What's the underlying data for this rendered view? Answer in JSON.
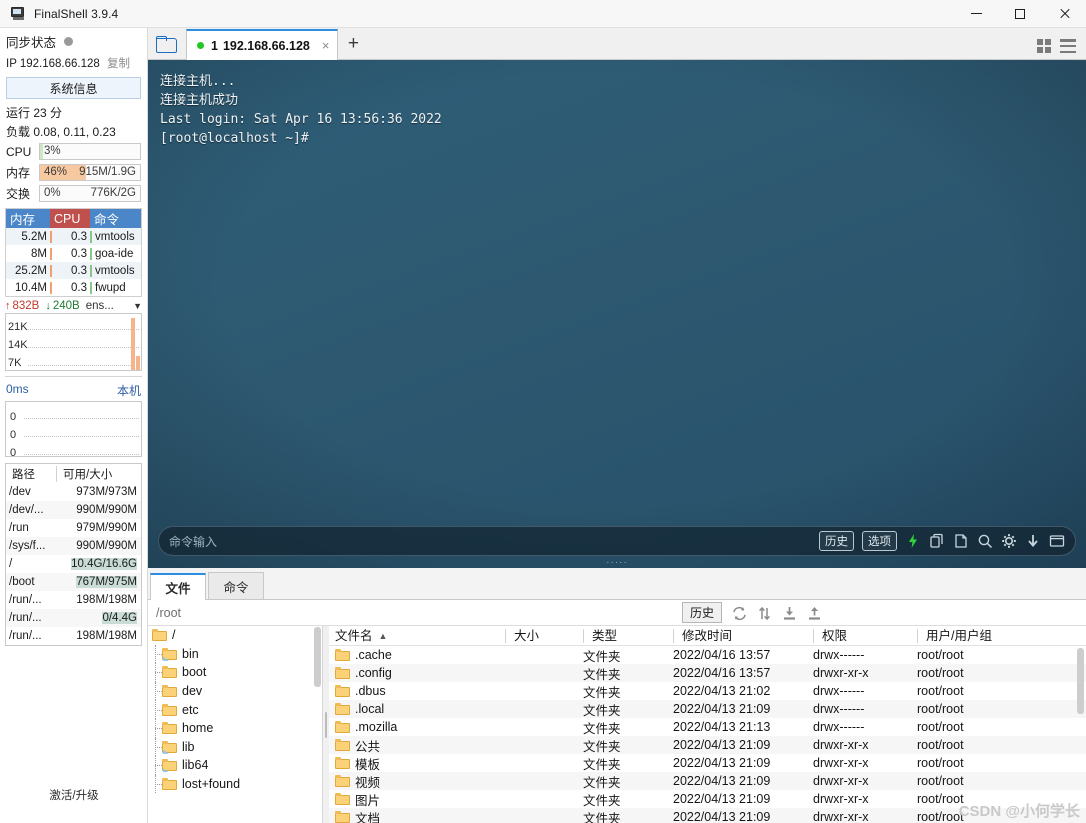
{
  "window": {
    "title": "FinalShell 3.9.4",
    "app_icon": "monitor-icon",
    "minimize": "—",
    "maximize": "□",
    "close": "✕"
  },
  "tabstrip": {
    "open_icon": "open-folder-icon",
    "tab": {
      "index": "1",
      "host": "192.168.66.128",
      "close": "×",
      "status": "connected"
    },
    "new_tab": "+",
    "grid_icon": "grid-view-icon",
    "menu_icon": "hamburger-menu-icon"
  },
  "sidebar": {
    "sync_label": "同步状态",
    "ip_label": "IP 192.168.66.128",
    "copy_label": "复制",
    "sysinfo_button": "系统信息",
    "uptime": "运行 23 分",
    "load": "负载 0.08, 0.11, 0.23",
    "meters": [
      {
        "label": "CPU",
        "percent": "3%",
        "value": "",
        "fill": 3,
        "color": "#cde9c0"
      },
      {
        "label": "内存",
        "percent": "46%",
        "value": "915M/1.9G",
        "fill": 46,
        "color": "#f7c9a0"
      },
      {
        "label": "交换",
        "percent": "0%",
        "value": "776K/2G",
        "fill": 0,
        "color": "#f7c9a0"
      }
    ],
    "process_table": {
      "headers": [
        "内存",
        "CPU",
        "命令"
      ],
      "header_colors": [
        "#4a86c8",
        "#c0504d",
        "#4a86c8"
      ],
      "rows": [
        [
          "5.2M",
          "0.3",
          "vmtools"
        ],
        [
          "8M",
          "0.3",
          "goa-ide"
        ],
        [
          "25.2M",
          "0.3",
          "vmtools"
        ],
        [
          "10.4M",
          "0.3",
          "fwupd"
        ]
      ]
    },
    "network": {
      "up": "832B",
      "down": "240B",
      "interface": "ens...",
      "up_arrow": "↑",
      "down_arrow": "↓",
      "caret": "▼",
      "y_labels": [
        "21K",
        "14K",
        "7K"
      ]
    },
    "latency": {
      "value": "0ms",
      "right_label": "本机",
      "y_labels": [
        "0",
        "0",
        "0"
      ]
    },
    "disk": {
      "headers": [
        "路径",
        "可用/大小"
      ],
      "rows": [
        {
          "path": "/dev",
          "value": "973M/973M",
          "highlight": false
        },
        {
          "path": "/dev/...",
          "value": "990M/990M",
          "highlight": false
        },
        {
          "path": "/run",
          "value": "979M/990M",
          "highlight": false
        },
        {
          "path": "/sys/f...",
          "value": "990M/990M",
          "highlight": false
        },
        {
          "path": "/",
          "value": "10.4G/16.6G",
          "highlight": true
        },
        {
          "path": "/boot",
          "value": "767M/975M",
          "highlight": true
        },
        {
          "path": "/run/...",
          "value": "198M/198M",
          "highlight": false
        },
        {
          "path": "/run/...",
          "value": "0/4.4G",
          "highlight": true
        },
        {
          "path": "/run/...",
          "value": "198M/198M",
          "highlight": false
        }
      ]
    },
    "activate": "激活/升级"
  },
  "terminal": {
    "lines": "连接主机...\n连接主机成功\nLast login: Sat Apr 16 13:56:36 2022\n[root@localhost ~]#",
    "command_placeholder": "命令输入",
    "history_button": "历史",
    "options_button": "选项",
    "icons": [
      "lightning-icon",
      "copy-icon",
      "paste-icon",
      "search-icon",
      "gear-icon",
      "download-icon",
      "window-icon"
    ],
    "drag_dots": "·····"
  },
  "file_panel": {
    "tabs": [
      {
        "label": "文件",
        "active": true
      },
      {
        "label": "命令",
        "active": false
      }
    ],
    "path": "/root",
    "history_button": "历史",
    "toolbar_icons": [
      "refresh-icon",
      "transfer-icon",
      "download-icon",
      "upload-icon"
    ],
    "tree": [
      {
        "label": "/",
        "depth": 0,
        "link": false
      },
      {
        "label": "bin",
        "depth": 1,
        "link": true
      },
      {
        "label": "boot",
        "depth": 1,
        "link": false
      },
      {
        "label": "dev",
        "depth": 1,
        "link": false
      },
      {
        "label": "etc",
        "depth": 1,
        "link": false
      },
      {
        "label": "home",
        "depth": 1,
        "link": false
      },
      {
        "label": "lib",
        "depth": 1,
        "link": true
      },
      {
        "label": "lib64",
        "depth": 1,
        "link": true
      },
      {
        "label": "lost+found",
        "depth": 1,
        "link": false
      }
    ],
    "columns": [
      "文件名",
      "大小",
      "类型",
      "修改时间",
      "权限",
      "用户/用户组"
    ],
    "sort_arrow": "▲",
    "rows": [
      {
        "name": ".cache",
        "size": "",
        "type": "文件夹",
        "mtime": "2022/04/16 13:57",
        "perm": "drwx------",
        "owner": "root/root"
      },
      {
        "name": ".config",
        "size": "",
        "type": "文件夹",
        "mtime": "2022/04/16 13:57",
        "perm": "drwxr-xr-x",
        "owner": "root/root"
      },
      {
        "name": ".dbus",
        "size": "",
        "type": "文件夹",
        "mtime": "2022/04/13 21:02",
        "perm": "drwx------",
        "owner": "root/root"
      },
      {
        "name": ".local",
        "size": "",
        "type": "文件夹",
        "mtime": "2022/04/13 21:09",
        "perm": "drwx------",
        "owner": "root/root"
      },
      {
        "name": ".mozilla",
        "size": "",
        "type": "文件夹",
        "mtime": "2022/04/13 21:13",
        "perm": "drwx------",
        "owner": "root/root"
      },
      {
        "name": "公共",
        "size": "",
        "type": "文件夹",
        "mtime": "2022/04/13 21:09",
        "perm": "drwxr-xr-x",
        "owner": "root/root"
      },
      {
        "name": "模板",
        "size": "",
        "type": "文件夹",
        "mtime": "2022/04/13 21:09",
        "perm": "drwxr-xr-x",
        "owner": "root/root"
      },
      {
        "name": "视频",
        "size": "",
        "type": "文件夹",
        "mtime": "2022/04/13 21:09",
        "perm": "drwxr-xr-x",
        "owner": "root/root"
      },
      {
        "name": "图片",
        "size": "",
        "type": "文件夹",
        "mtime": "2022/04/13 21:09",
        "perm": "drwxr-xr-x",
        "owner": "root/root"
      },
      {
        "name": "文档",
        "size": "",
        "type": "文件夹",
        "mtime": "2022/04/13 21:09",
        "perm": "drwxr-xr-x",
        "owner": "root/root"
      }
    ],
    "watermark": "CSDN @小何学长"
  }
}
